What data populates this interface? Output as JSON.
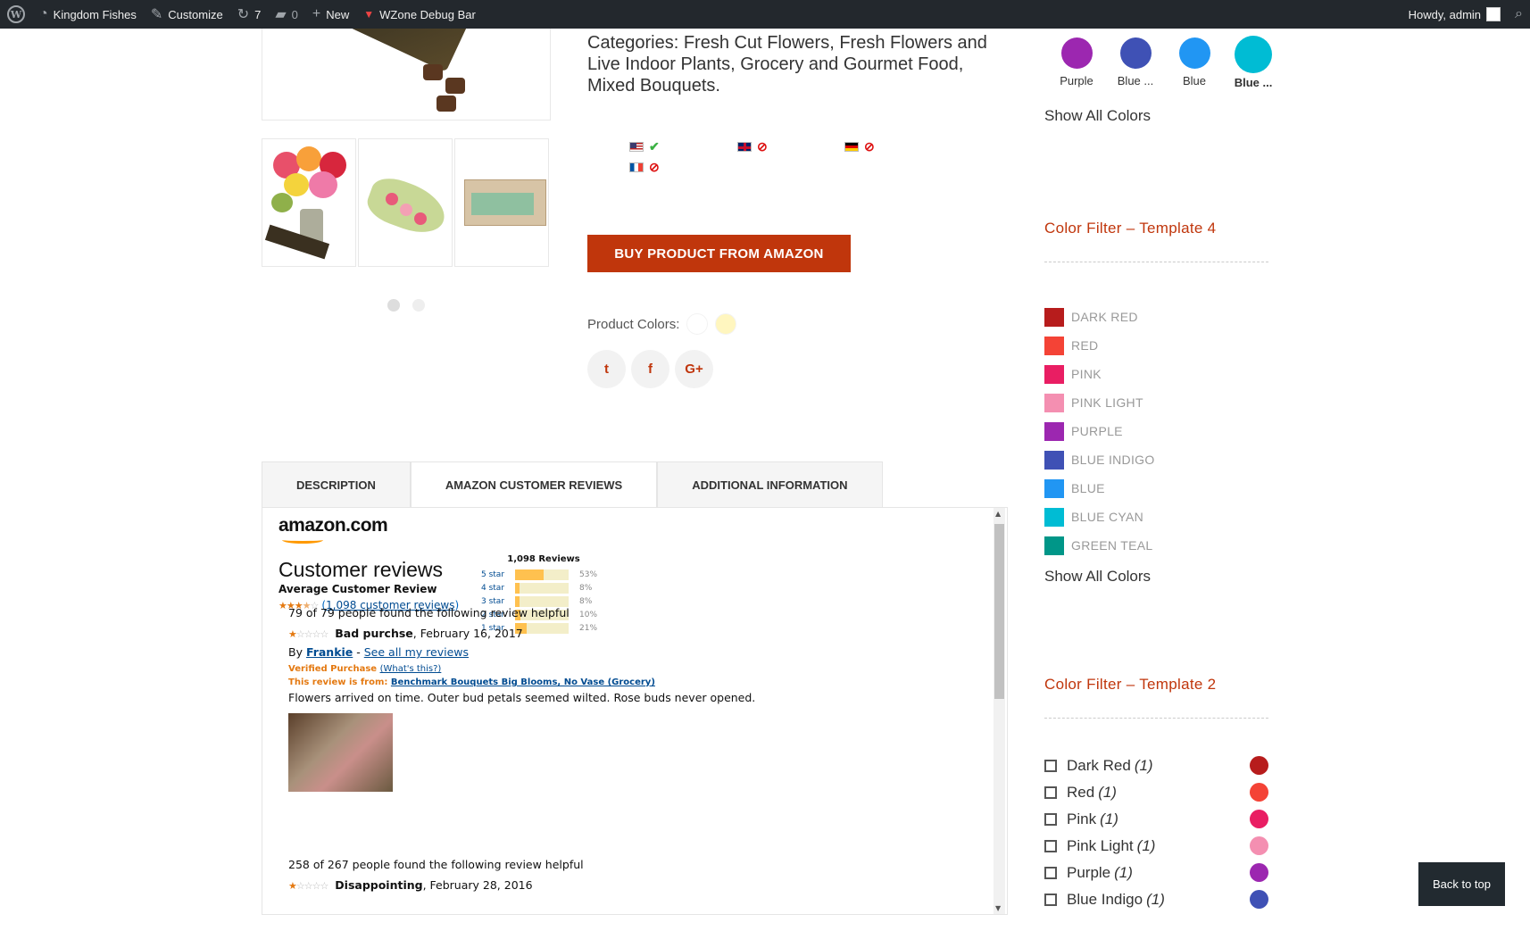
{
  "adminbar": {
    "site_name": "Kingdom Fishes",
    "customize": "Customize",
    "updates_count": "7",
    "comments_count": "0",
    "new_label": "New",
    "debug_bar": "WZone Debug Bar",
    "howdy": "Howdy, admin"
  },
  "product": {
    "categories": "Categories: Fresh Cut Flowers, Fresh Flowers and Live Indoor Plants, Grocery and Gourmet Food, Mixed Bouquets.",
    "markets": [
      {
        "country": "us",
        "available": true
      },
      {
        "country": "uk",
        "available": false
      },
      {
        "country": "de",
        "available": false
      },
      {
        "country": "fr",
        "available": false
      }
    ],
    "buy_button": "BUY PRODUCT FROM AMAZON",
    "colors_label": "Product Colors:",
    "colors": [
      "#ffffff",
      "#fff6bf"
    ],
    "social": {
      "twitter": "t",
      "facebook": "f",
      "google": "G+"
    }
  },
  "tabs": [
    {
      "label": "DESCRIPTION",
      "active": false
    },
    {
      "label": "AMAZON CUSTOMER REVIEWS",
      "active": true
    },
    {
      "label": "ADDITIONAL INFORMATION",
      "active": false
    }
  ],
  "reviews_panel": {
    "logo": "amazon.com",
    "title": "Customer reviews",
    "avg_label": "Average Customer Review",
    "review_link": "1,098 customer reviews",
    "total": "1,098 Reviews",
    "rating_stars": 3.5,
    "histogram": [
      {
        "label": "5 star",
        "pct": 53,
        "pct_text": "53%"
      },
      {
        "label": "4 star",
        "pct": 8,
        "pct_text": "8%"
      },
      {
        "label": "3 star",
        "pct": 8,
        "pct_text": "8%"
      },
      {
        "label": "2 star",
        "pct": 10,
        "pct_text": "10%"
      },
      {
        "label": "1 star",
        "pct": 21,
        "pct_text": "21%"
      }
    ],
    "reviews": [
      {
        "helpful": "79 of 79 people found the following review helpful",
        "stars": 1,
        "title": "Bad purchse",
        "date": ", February 16, 2017",
        "by": "By ",
        "author": "Frankie",
        "sep": " - ",
        "see_all": "See all my reviews",
        "verified": "Verified Purchase",
        "whats_this": "(What's this?)",
        "from_label": "This review is from: ",
        "from_product": "Benchmark Bouquets Big Blooms, No Vase (Grocery)",
        "text": "Flowers arrived on time. Outer bud petals seemed wilted. Rose buds never opened."
      },
      {
        "helpful": "258 of 267 people found the following review helpful",
        "stars": 1,
        "title": "Disappointing",
        "date": ", February 28, 2016"
      }
    ]
  },
  "sidebar": {
    "top_swatches": [
      {
        "label": "Purple",
        "color": "#9c27b0"
      },
      {
        "label": "Blue ...",
        "color": "#3f51b5"
      },
      {
        "label": "Blue",
        "color": "#2196f3"
      },
      {
        "label": "Blue ...",
        "color": "#00bcd4",
        "selected": true
      }
    ],
    "show_all": "Show All Colors",
    "t4_title": "Color Filter – Template 4",
    "t4_items": [
      {
        "label": "DARK RED",
        "color": "#b71c1c"
      },
      {
        "label": "RED",
        "color": "#f44336"
      },
      {
        "label": "PINK",
        "color": "#e91e63"
      },
      {
        "label": "PINK LIGHT",
        "color": "#f48fb1"
      },
      {
        "label": "PURPLE",
        "color": "#9c27b0"
      },
      {
        "label": "BLUE INDIGO",
        "color": "#3f51b5"
      },
      {
        "label": "BLUE",
        "color": "#2196f3"
      },
      {
        "label": "BLUE CYAN",
        "color": "#00bcd4"
      },
      {
        "label": "GREEN TEAL",
        "color": "#009688"
      }
    ],
    "show_all_2": "Show All Colors",
    "t2_title": "Color Filter – Template 2",
    "t2_items": [
      {
        "label": "Dark Red",
        "count": "(1)",
        "color": "#b71c1c"
      },
      {
        "label": "Red",
        "count": "(1)",
        "color": "#f44336"
      },
      {
        "label": "Pink",
        "count": "(1)",
        "color": "#e91e63"
      },
      {
        "label": "Pink Light",
        "count": "(1)",
        "color": "#f48fb1"
      },
      {
        "label": "Purple",
        "count": "(1)",
        "color": "#9c27b0"
      },
      {
        "label": "Blue Indigo",
        "count": "(1)",
        "color": "#3f51b5"
      }
    ]
  },
  "back_to_top": "Back to top"
}
